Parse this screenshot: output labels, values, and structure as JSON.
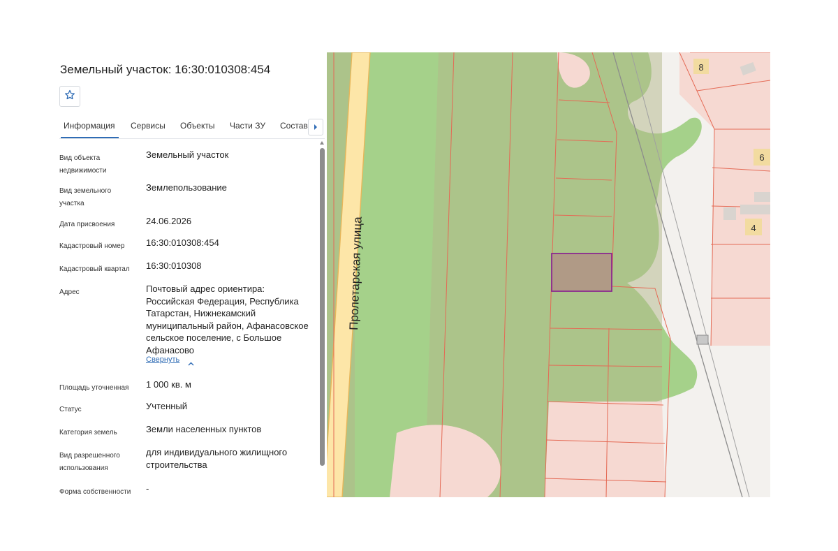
{
  "header": {
    "title": "Земельный участок: 16:30:010308:454"
  },
  "tabs": [
    {
      "label": "Информация",
      "active": true
    },
    {
      "label": "Сервисы",
      "active": false
    },
    {
      "label": "Объекты",
      "active": false
    },
    {
      "label": "Части ЗУ",
      "active": false
    },
    {
      "label": "Состав",
      "active": false
    }
  ],
  "info": {
    "object_type": {
      "label": "Вид объекта недвижимости",
      "value": "Земельный участок"
    },
    "plot_type": {
      "label": "Вид земельного участка",
      "value": "Землепользование"
    },
    "assign_date": {
      "label": "Дата присвоения",
      "value": "24.06.2026"
    },
    "cadastral_number": {
      "label": "Кадастровый номер",
      "value": "16:30:010308:454"
    },
    "cadastral_quarter": {
      "label": "Кадастровый квартал",
      "value": "16:30:010308"
    },
    "address": {
      "label": "Адрес",
      "value": "Почтовый адрес ориентира: Российская Федерация, Республика Татарстан, Нижнекамский муниципальный район, Афанасовское сельское поселение, с Большое Афанасово",
      "collapse_link": "Свернуть"
    },
    "area": {
      "label": "Площадь уточненная",
      "value": "1 000 кв. м"
    },
    "status": {
      "label": "Статус",
      "value": "Учтенный"
    },
    "land_category": {
      "label": "Категория земель",
      "value": "Земли населенных пунктов"
    },
    "permitted_use": {
      "label": "Вид разрешенного использования",
      "value": "для индивидуального жилищного строительства"
    },
    "ownership": {
      "label": "Форма собственности",
      "value": "-"
    }
  },
  "map": {
    "street_name": "Пролетарская улица",
    "house_numbers": [
      "8",
      "6",
      "4"
    ],
    "colors": {
      "green": "#a5d18a",
      "parcel_olive": "#b3b88a",
      "parcel_pink": "#f6d9d2",
      "parcel_border": "#e46a55",
      "selected_fill": "#b09a86",
      "selected_border": "#8b2a8f",
      "road_fill": "#fde6a8",
      "road_border": "#e7b65a"
    }
  }
}
